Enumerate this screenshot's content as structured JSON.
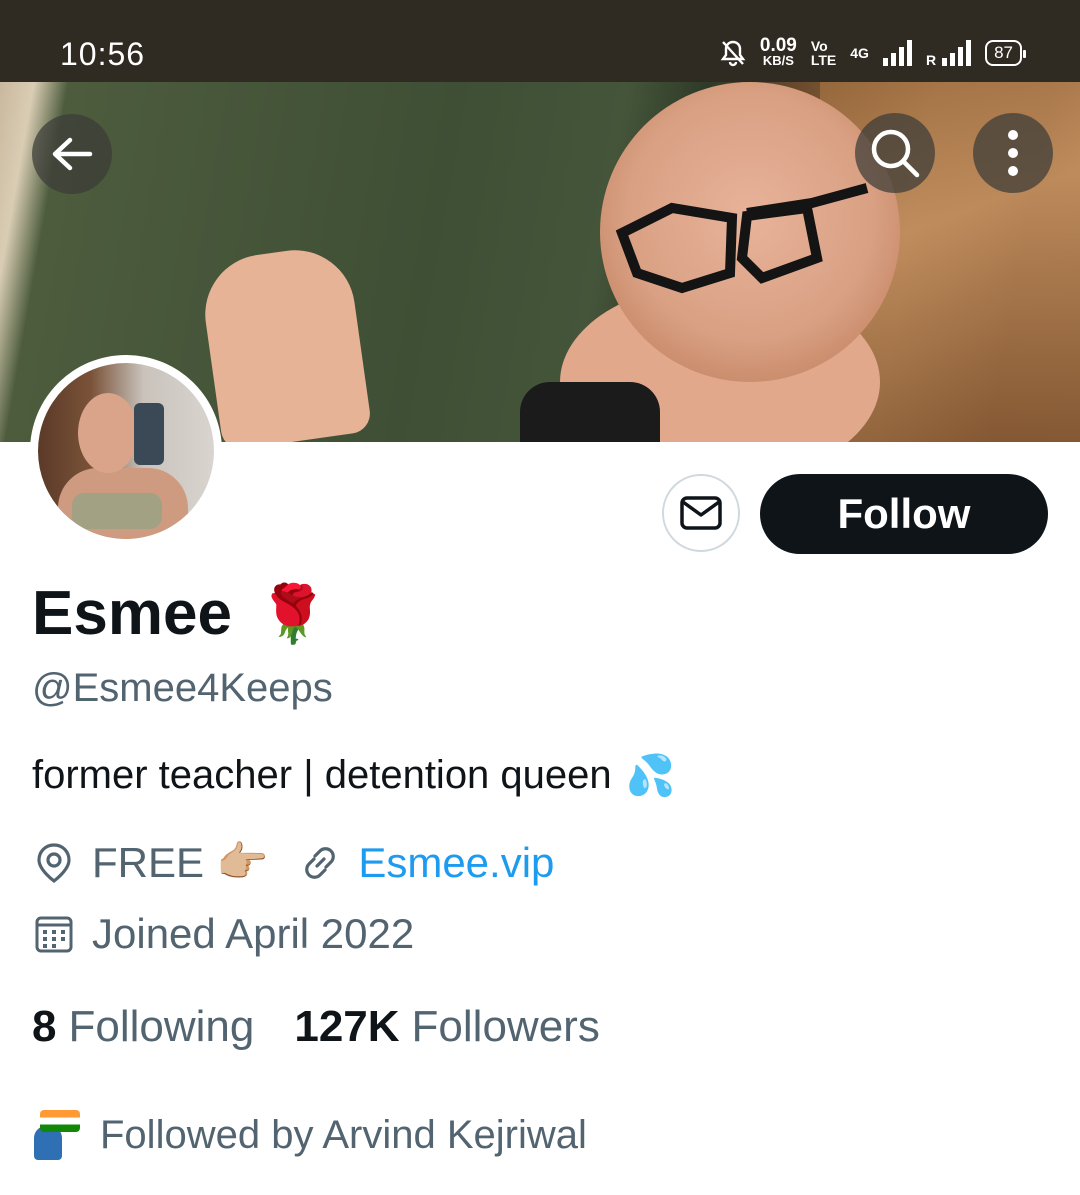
{
  "status_bar": {
    "time": "10:56",
    "net_speed_value": "0.09",
    "net_speed_unit": "KB/S",
    "volte_top": "Vo",
    "volte_bottom": "LTE",
    "network": "4G",
    "roaming": "R",
    "battery": "87"
  },
  "header": {
    "back_icon": "arrow-left-icon",
    "search_icon": "search-icon",
    "more_icon": "more-vertical-icon"
  },
  "profile": {
    "display_name": "Esmee",
    "name_emoji": "🌹",
    "handle": "@Esmee4Keeps",
    "bio": "former teacher | detention queen",
    "bio_emoji": "💦",
    "location": "FREE",
    "location_emoji": "👉🏼",
    "website": "Esmee.vip",
    "joined": "Joined April 2022",
    "following_count": "8",
    "following_label": "Following",
    "followers_count": "127K",
    "followers_label": "Followers",
    "followed_by": "Followed by Arvind Kejriwal"
  },
  "actions": {
    "message_icon": "envelope-icon",
    "follow_label": "Follow"
  },
  "colors": {
    "primary_text": "#0f1419",
    "secondary_text": "#536471",
    "link": "#1d9bf0",
    "follow_bg": "#0f1419",
    "status_bar_bg": "#2f2a22"
  }
}
